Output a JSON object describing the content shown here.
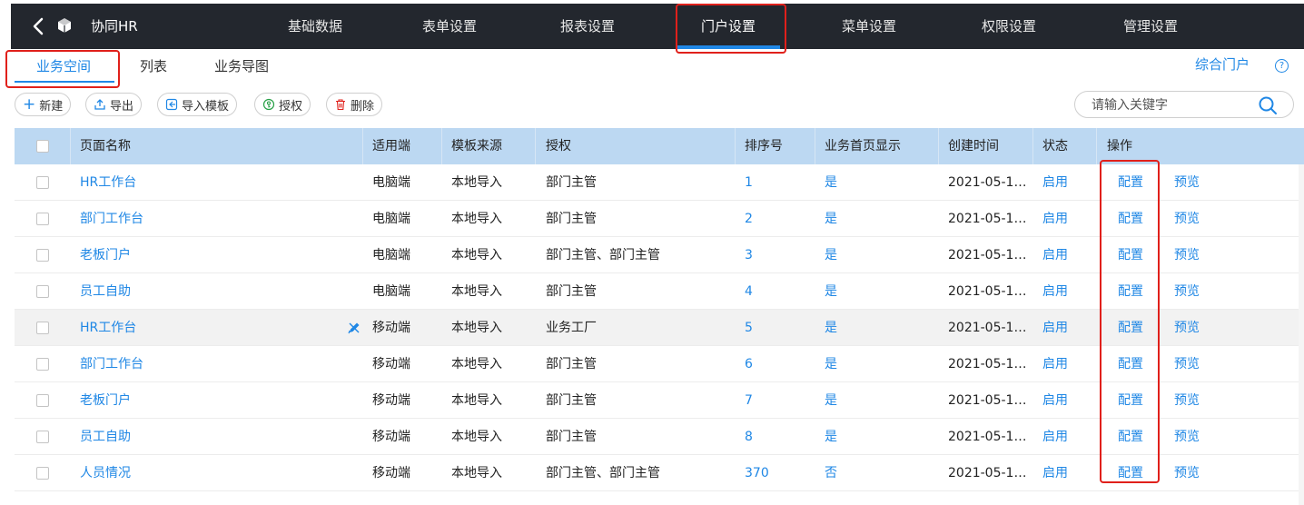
{
  "app": {
    "name": "协同HR"
  },
  "nav": {
    "items": [
      {
        "label": "基础数据"
      },
      {
        "label": "表单设置"
      },
      {
        "label": "报表设置"
      },
      {
        "label": "门户设置"
      },
      {
        "label": "菜单设置"
      },
      {
        "label": "权限设置"
      },
      {
        "label": "管理设置"
      }
    ],
    "active_index": 3
  },
  "subtabs": {
    "items": [
      {
        "label": "业务空间"
      },
      {
        "label": "列表"
      },
      {
        "label": "业务导图"
      }
    ],
    "active_index": 0
  },
  "portal_link": "综合门户",
  "help_glyph": "?",
  "toolbar": {
    "new_label": "新建",
    "export_label": "导出",
    "import_label": "导入模板",
    "auth_label": "授权",
    "delete_label": "删除"
  },
  "search": {
    "placeholder": "请输入关键字"
  },
  "table": {
    "columns": [
      "页面名称",
      "适用端",
      "模板来源",
      "授权",
      "排序号",
      "业务首页显示",
      "创建时间",
      "状态",
      "操作"
    ],
    "action_config": "配置",
    "action_preview": "预览",
    "rows": [
      {
        "name": "HR工作台",
        "terminal": "电脑端",
        "source": "本地导入",
        "auth": "部门主管",
        "order": "1",
        "home": "是",
        "created": "2021-05-1…",
        "status": "启用"
      },
      {
        "name": "部门工作台",
        "terminal": "电脑端",
        "source": "本地导入",
        "auth": "部门主管",
        "order": "2",
        "home": "是",
        "created": "2021-05-1…",
        "status": "启用"
      },
      {
        "name": "老板门户",
        "terminal": "电脑端",
        "source": "本地导入",
        "auth": "部门主管、部门主管",
        "order": "3",
        "home": "是",
        "created": "2021-05-1…",
        "status": "启用"
      },
      {
        "name": "员工自助",
        "terminal": "电脑端",
        "source": "本地导入",
        "auth": "部门主管",
        "order": "4",
        "home": "是",
        "created": "2021-05-1…",
        "status": "启用"
      },
      {
        "name": "HR工作台",
        "terminal": "移动端",
        "source": "本地导入",
        "auth": "业务工厂",
        "order": "5",
        "home": "是",
        "created": "2021-05-1…",
        "status": "启用"
      },
      {
        "name": "部门工作台",
        "terminal": "移动端",
        "source": "本地导入",
        "auth": "部门主管",
        "order": "6",
        "home": "是",
        "created": "2021-05-1…",
        "status": "启用"
      },
      {
        "name": "老板门户",
        "terminal": "移动端",
        "source": "本地导入",
        "auth": "部门主管",
        "order": "7",
        "home": "是",
        "created": "2021-05-1…",
        "status": "启用"
      },
      {
        "name": "员工自助",
        "terminal": "移动端",
        "source": "本地导入",
        "auth": "部门主管",
        "order": "8",
        "home": "是",
        "created": "2021-05-1…",
        "status": "启用"
      },
      {
        "name": "人员情况",
        "terminal": "移动端",
        "source": "本地导入",
        "auth": "部门主管、部门主管",
        "order": "370",
        "home": "否",
        "created": "2021-05-1…",
        "status": "启用"
      }
    ]
  },
  "colors": {
    "accent": "#1f87e5",
    "topbar": "#23272e",
    "header_bg": "#bcd8f2",
    "highlight": "#e0201b"
  }
}
